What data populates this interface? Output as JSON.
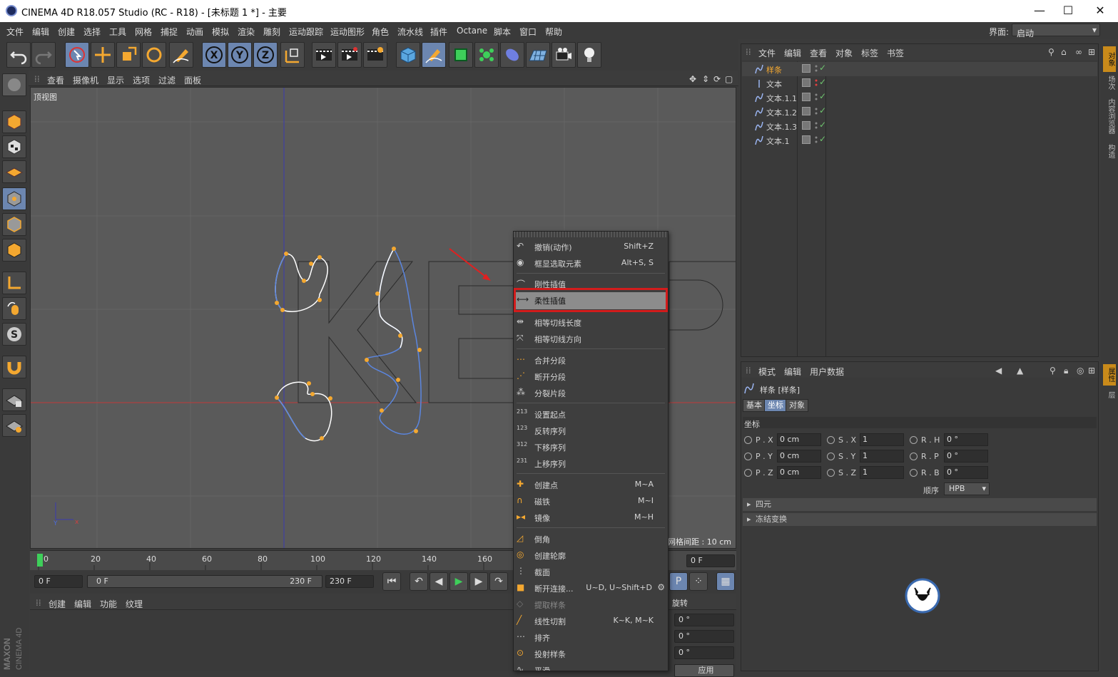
{
  "window": {
    "title": "CINEMA 4D R18.057 Studio (RC - R18) - [未标题 1 *] - 主要",
    "min": "—",
    "max": "☐",
    "close": "✕"
  },
  "menubar": [
    "文件",
    "编辑",
    "创建",
    "选择",
    "工具",
    "网格",
    "捕捉",
    "动画",
    "模拟",
    "渲染",
    "雕刻",
    "运动跟踪",
    "运动图形",
    "角色",
    "流水线",
    "插件",
    "Octane",
    "脚本",
    "窗口",
    "帮助"
  ],
  "interface": {
    "label": "界面:",
    "value": "启动"
  },
  "viewport_menu": [
    "查看",
    "摄像机",
    "显示",
    "选项",
    "过滤",
    "面板"
  ],
  "viewport": {
    "name": "顶视图",
    "grid_spacing": "网格间距 : 10 cm"
  },
  "timeline": {
    "ticks": [
      "0",
      "20",
      "40",
      "60",
      "80",
      "100",
      "120",
      "140",
      "160"
    ],
    "start_frame": "0 F",
    "range_start": "0 F",
    "range_end": "230 F",
    "end_frame": "230 F",
    "current_frame": "0 F"
  },
  "material_menu": [
    "创建",
    "编辑",
    "功能",
    "纹理"
  ],
  "coord_panel": {
    "rotate_label": "旋转",
    "r_values": [
      "0 °",
      "0 °",
      "0 °"
    ],
    "apply": "应用"
  },
  "objects_menu": [
    "文件",
    "编辑",
    "查看",
    "对象",
    "标签",
    "书签"
  ],
  "objects": [
    {
      "name": "样条",
      "icon": "spline-icon",
      "highlight": true
    },
    {
      "name": "文本",
      "icon": "text-icon",
      "highlight": false
    },
    {
      "name": "文本.1.1",
      "icon": "spline-icon",
      "highlight": false
    },
    {
      "name": "文本.1.2",
      "icon": "spline-icon",
      "highlight": false
    },
    {
      "name": "文本.1.3",
      "icon": "spline-icon",
      "highlight": false
    },
    {
      "name": "文本.1",
      "icon": "spline-icon",
      "highlight": false
    }
  ],
  "attributes": {
    "menu": [
      "模式",
      "编辑",
      "用户数据"
    ],
    "object_title": "样条 [样条]",
    "tabs": [
      {
        "label": "基本",
        "active": false
      },
      {
        "label": "坐标",
        "active": true
      },
      {
        "label": "对象",
        "active": false
      }
    ],
    "section": "坐标",
    "rows": [
      {
        "p": "P . X",
        "pv": "0 cm",
        "s": "S . X",
        "sv": "1",
        "r": "R . H",
        "rv": "0 °"
      },
      {
        "p": "P . Y",
        "pv": "0 cm",
        "s": "S . Y",
        "sv": "1",
        "r": "R . P",
        "rv": "0 °"
      },
      {
        "p": "P . Z",
        "pv": "0 cm",
        "s": "S . Z",
        "sv": "1",
        "r": "R . B",
        "rv": "0 °"
      }
    ],
    "order_label": "顺序",
    "order_value": "HPB",
    "collapsed": [
      "四元",
      "冻结变换"
    ]
  },
  "right_tabs": [
    "对象",
    "场次",
    "内容浏览器",
    "构造",
    "属性",
    "层"
  ],
  "context_menu": {
    "items": [
      {
        "label": "撤销(动作)",
        "shortcut": "Shift+Z",
        "icon": "undo-icon",
        "state": "normal"
      },
      {
        "label": "框显选取元素",
        "shortcut": "Alt+S, S",
        "icon": "frame-icon",
        "state": "normal"
      },
      {
        "label": "刚性插值",
        "shortcut": "",
        "icon": "rigid-interp-icon",
        "state": "normal"
      },
      {
        "label": "柔性插值",
        "shortcut": "",
        "icon": "soft-interp-icon",
        "state": "hover"
      },
      {
        "label": "相等切线长度",
        "shortcut": "",
        "icon": "tangent-length-icon",
        "state": "normal"
      },
      {
        "label": "相等切线方向",
        "shortcut": "",
        "icon": "tangent-direction-icon",
        "state": "normal"
      },
      {
        "label": "合并分段",
        "shortcut": "",
        "icon": "join-segment-icon",
        "state": "normal"
      },
      {
        "label": "断开分段",
        "shortcut": "",
        "icon": "break-segment-icon",
        "state": "normal"
      },
      {
        "label": "分裂片段",
        "shortcut": "",
        "icon": "explode-segment-icon",
        "state": "normal"
      },
      {
        "label": "设置起点",
        "shortcut": "",
        "icon": "first-point-icon",
        "state": "normal"
      },
      {
        "label": "反转序列",
        "shortcut": "",
        "icon": "reverse-sequence-icon",
        "state": "normal"
      },
      {
        "label": "下移序列",
        "shortcut": "",
        "icon": "move-down-sequence-icon",
        "state": "normal"
      },
      {
        "label": "上移序列",
        "shortcut": "",
        "icon": "move-up-sequence-icon",
        "state": "normal"
      },
      {
        "label": "创建点",
        "shortcut": "M~A",
        "icon": "create-point-icon",
        "state": "normal"
      },
      {
        "label": "磁铁",
        "shortcut": "M~I",
        "icon": "magnet-icon",
        "state": "normal"
      },
      {
        "label": "镜像",
        "shortcut": "M~H",
        "icon": "mirror-icon",
        "state": "normal"
      },
      {
        "label": "倒角",
        "shortcut": "",
        "icon": "chamfer-icon",
        "state": "normal"
      },
      {
        "label": "创建轮廓",
        "shortcut": "",
        "icon": "outline-icon",
        "state": "normal"
      },
      {
        "label": "截面",
        "shortcut": "",
        "icon": "cross-section-icon",
        "state": "normal"
      },
      {
        "label": "断开连接...",
        "shortcut": "U~D, U~Shift+D",
        "icon": "disconnect-icon",
        "state": "normal"
      },
      {
        "label": "提取样条",
        "shortcut": "",
        "icon": "extract-spline-icon",
        "state": "dim"
      },
      {
        "label": "线性切割",
        "shortcut": "K~K, M~K",
        "icon": "line-cut-icon",
        "state": "normal"
      },
      {
        "label": "排齐",
        "shortcut": "",
        "icon": "line-up-icon",
        "state": "normal"
      },
      {
        "label": "投射样条",
        "shortcut": "",
        "icon": "project-spline-icon",
        "state": "normal"
      },
      {
        "label": "平滑",
        "shortcut": "",
        "icon": "smooth-icon",
        "state": "normal"
      }
    ]
  },
  "branding": {
    "logo": "MAXON CINEMA 4D"
  },
  "colors": {
    "accent": "#6c86b0",
    "highlight_box": "#d21c1c",
    "spline_point": "#f4a830",
    "spline_blue": "#5b86e0"
  }
}
